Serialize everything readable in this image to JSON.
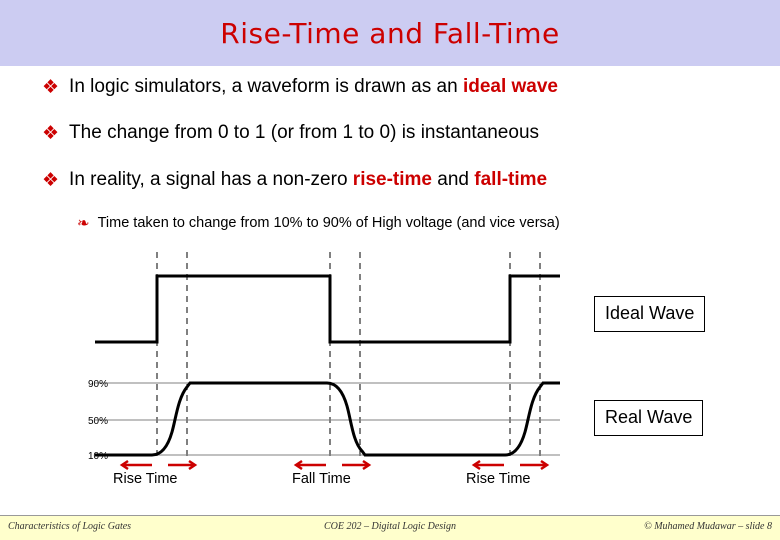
{
  "slide": {
    "title": "Rise-Time and Fall-Time",
    "title_color": "#cc0000",
    "banner_color": "#ccccf2",
    "bullets": [
      {
        "marker": "❖",
        "level": 1,
        "parts": [
          {
            "text": "In logic simulators, a waveform is drawn as an ",
            "emphasis": false
          },
          {
            "text": "ideal wave",
            "emphasis": true
          }
        ]
      },
      {
        "marker": "❖",
        "level": 1,
        "parts": [
          {
            "text": "The change from 0 to 1 (or from 1 to 0) is instantaneous",
            "emphasis": false
          }
        ]
      },
      {
        "marker": "❖",
        "level": 1,
        "parts": [
          {
            "text": "In reality, a signal has a non-zero ",
            "emphasis": false
          },
          {
            "text": "rise-time",
            "emphasis": true
          },
          {
            "text": " and ",
            "emphasis": false
          },
          {
            "text": "fall-time",
            "emphasis": true
          }
        ]
      },
      {
        "marker": "❧",
        "level": 2,
        "parts": [
          {
            "text": "Time taken to change from 10% to 90% of High voltage (and vice versa)",
            "emphasis": false
          }
        ]
      }
    ],
    "diagram": {
      "ideal_label": "Ideal Wave",
      "real_label": "Real Wave",
      "voltage_labels": [
        "90%",
        "50%",
        "10%"
      ],
      "time_labels": [
        "Rise Time",
        "Fall Time",
        "Rise Time"
      ]
    },
    "footer": {
      "left": "Characteristics of Logic Gates",
      "center": "COE 202 – Digital Logic Design",
      "right": "© Muhamed Mudawar – slide 8"
    }
  }
}
